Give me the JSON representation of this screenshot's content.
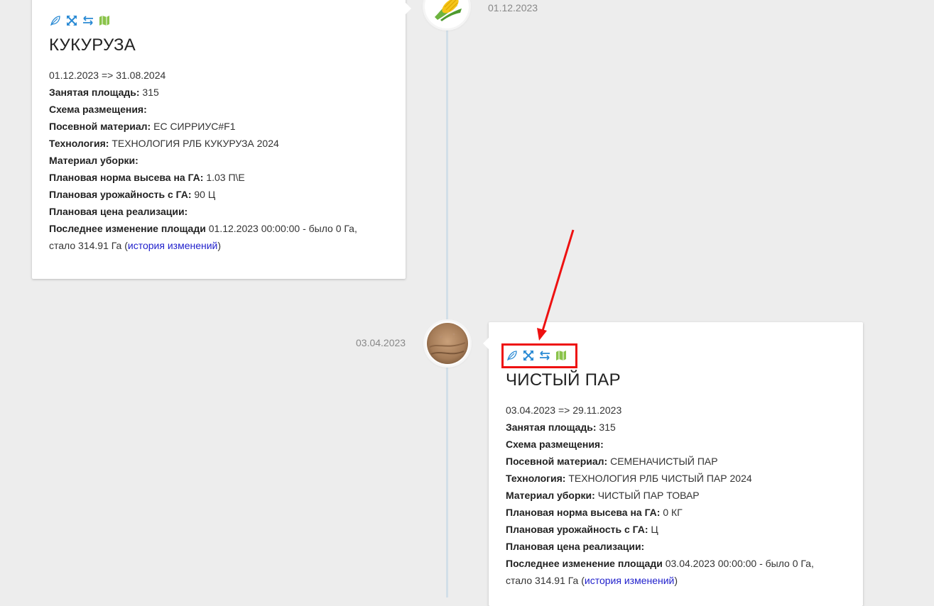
{
  "timeline": {
    "entries": [
      {
        "date": "01.12.2023",
        "title": "КУКУРУЗА",
        "period": "01.12.2023 => 31.08.2024",
        "occupied_area_label": "Занятая площадь:",
        "occupied_area_value": "315",
        "placement_scheme_label": "Схема размещения:",
        "seed_material_label": "Посевной материал:",
        "seed_material_value": "ЕС СИРРИУС#F1",
        "technology_label": "Технология:",
        "technology_value": "ТЕХНОЛОГИЯ РЛБ КУКУРУЗА 2024",
        "harvest_material_label": "Материал уборки:",
        "harvest_material_value": "",
        "seeding_rate_label": "Плановая норма высева на ГА:",
        "seeding_rate_value": "1.03 П\\Е",
        "yield_label": "Плановая урожайность с ГА:",
        "yield_value": "90 Ц",
        "price_label": "Плановая цена реализации:",
        "last_change_label": "Последнее изменение площади",
        "last_change_value_line1": "01.12.2023 00:00:00 - было 0 Га,",
        "last_change_value_line2": "стало 314.91 Га (",
        "history_link": "история изменений",
        "close_paren": ")",
        "icon": "corn-icon"
      },
      {
        "date": "03.04.2023",
        "title": "ЧИСТЫЙ ПАР",
        "period": "03.04.2023 => 29.11.2023",
        "occupied_area_label": "Занятая площадь:",
        "occupied_area_value": "315",
        "placement_scheme_label": "Схема размещения:",
        "seed_material_label": "Посевной материал:",
        "seed_material_value": "СЕМЕНАЧИСТЫЙ ПАР",
        "technology_label": "Технология:",
        "technology_value": "ТЕХНОЛОГИЯ РЛБ ЧИСТЫЙ ПАР 2024",
        "harvest_material_label": "Материал уборки:",
        "harvest_material_value": "ЧИСТЫЙ ПАР ТОВАР",
        "seeding_rate_label": "Плановая норма высева на ГА:",
        "seeding_rate_value": "0 КГ",
        "yield_label": "Плановая урожайность с ГА:",
        "yield_value": "Ц",
        "price_label": "Плановая цена реализации:",
        "last_change_label": "Последнее изменение площади",
        "last_change_value_line1": "03.04.2023 00:00:00 - было 0 Га,",
        "last_change_value_line2": "стало 314.91 Га (",
        "history_link": "история изменений",
        "close_paren": ")",
        "icon": "soil-icon"
      }
    ]
  },
  "action_icons": [
    "leaf-icon",
    "expand-icon",
    "swap-icon",
    "map-icon"
  ],
  "colors": {
    "background": "#ededed",
    "timeline_line": "#d2dfe8",
    "icon_green": "#8ac34a",
    "icon_blue": "#2a8ad4",
    "link": "#2222cc",
    "highlight": "#ee1111"
  }
}
